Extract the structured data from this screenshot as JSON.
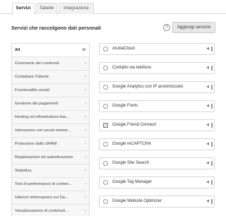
{
  "tabs": [
    {
      "label": "Servizi"
    },
    {
      "label": "Tabelle"
    },
    {
      "label": "Integrazione"
    }
  ],
  "heading": "Servizi che raccolgono dati personali",
  "help": "?",
  "add_button": "Aggiungi servizio",
  "sidebar": {
    "items": [
      {
        "label": "All",
        "active": true
      },
      {
        "label": "Commento dei contenuti"
      },
      {
        "label": "Contattare l'Utente"
      },
      {
        "label": "Funzionalità sociali"
      },
      {
        "label": "Gestione dei pagamenti"
      },
      {
        "label": "Hosting ed infrastruttura bac..."
      },
      {
        "label": "Interazione con social networ..."
      },
      {
        "label": "Protezione dallo SPAM"
      },
      {
        "label": "Registrazione ed autenticazione"
      },
      {
        "label": "Statistica"
      },
      {
        "label": "Test di performance di conten..."
      },
      {
        "label": "Ulteriori informazioni sui Da..."
      },
      {
        "label": "Visualizzazione di contenuti ..."
      }
    ]
  },
  "services": [
    {
      "name": "ArubaCloud"
    },
    {
      "name": "Contatto via telefono"
    },
    {
      "name": "Google Analytics con IP anonimizzato"
    },
    {
      "name": "Google Fonts"
    },
    {
      "name": "Google Friend Connect"
    },
    {
      "name": "Google reCAPTCHA"
    },
    {
      "name": "Google Site Search"
    },
    {
      "name": "Google Tag Manager"
    },
    {
      "name": "Google Website Optimizer"
    }
  ],
  "icons": {
    "sidebar_arrow": "›",
    "chevron": "◀",
    "side_all_arrow": "≫"
  }
}
